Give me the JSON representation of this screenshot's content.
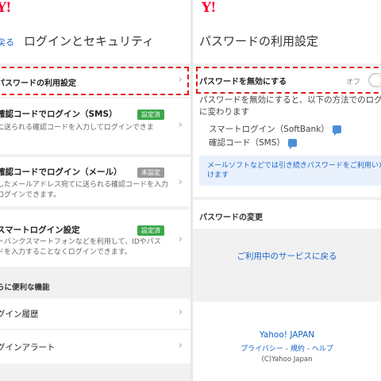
{
  "left": {
    "logo": "Y!",
    "back_label": "戻る",
    "title": "ログインとセキュリティ",
    "password_setting": "パスワードの利用設定",
    "sms_login": {
      "title": "確認コードでログイン（SMS）",
      "badge": "設定済",
      "desc": "に送られる確認コードを入力してログインできま"
    },
    "mail_login": {
      "title": "確認コードでログイン（メール）",
      "badge": "未設定",
      "desc_line1": "したメールアドレス宛てに送られる確認コードを入力",
      "desc_line2": "ログインできます。"
    },
    "smart_login": {
      "title": "スマートログイン設定",
      "badge": "設定済",
      "desc_line1": "トバンクスマートフォンなどを利用して、IDやパス",
      "desc_line2": "ドを入力することなくログインできます。"
    },
    "section_label": "らに便利な機能",
    "login_history": "グイン履歴",
    "login_alert": "グインアラート"
  },
  "right": {
    "logo": "Y!",
    "title": "パスワードの利用設定",
    "disable_label": "パスワードを無効にする",
    "toggle_state": "オフ",
    "desc_line1": "パスワードを無効にすると、以下の方法でのログ",
    "desc_line2": "に変わります",
    "method1": "スマートログイン（SoftBank）",
    "method2": "確認コード（SMS）",
    "info_line1": "メールソフトなどでは引き続きパスワードをご利用いた",
    "info_line2": "けます",
    "change_header": "パスワードの変更",
    "back_to_service": "ご利用中のサービスに戻る",
    "footer_brand": "Yahoo! JAPAN",
    "footer_privacy": "プライバシー",
    "footer_sep": " - ",
    "footer_terms": "規約",
    "footer_help": "ヘルプ",
    "footer_copy": "(C)Yahoo Japan"
  }
}
